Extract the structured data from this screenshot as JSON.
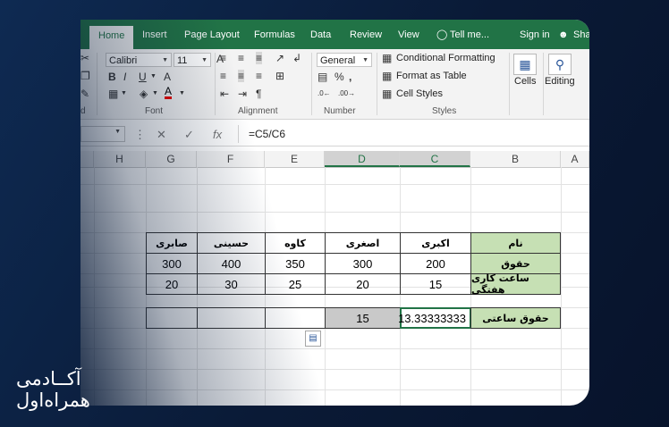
{
  "brand": {
    "line1": "آکــادمی",
    "line2": "همراه‌اول"
  },
  "tabs": {
    "home": "Home",
    "insert": "Insert",
    "page_layout": "Page Layout",
    "formulas": "Formulas",
    "data": "Data",
    "review": "Review",
    "view": "View",
    "tell_me": "Tell me...",
    "signin": "Sign in",
    "share": "Sha"
  },
  "ribbon": {
    "font_name": "Calibri",
    "font_size": "11",
    "number_format": "General",
    "conditional_formatting": "Conditional Formatting",
    "format_as_table": "Format as Table",
    "cell_styles": "Cell Styles",
    "cells": "Cells",
    "editing": "Editing",
    "groups": {
      "clipboard": "d",
      "font": "Font",
      "alignment": "Alignment",
      "number": "Number",
      "styles": "Styles"
    },
    "bold": "B",
    "italic": "I",
    "underline": "U",
    "font_color": "A",
    "percent": "%",
    "comma": ","
  },
  "formula_bar": {
    "formula": "=C5/C6",
    "fx": "fx"
  },
  "columns": [
    "H",
    "G",
    "F",
    "E",
    "D",
    "C",
    "B",
    "A"
  ],
  "table": {
    "header_label": "نام",
    "names": [
      "صابری",
      "حسینی",
      "کاوه",
      "اصغری",
      "اکبری"
    ],
    "row_salary_label": "حقوق",
    "salary": [
      "300",
      "400",
      "350",
      "300",
      "200"
    ],
    "row_hours_label": "ساعت کاری هفتگی",
    "hours": [
      "20",
      "30",
      "25",
      "20",
      "15"
    ],
    "row_hourly_label": "حقوق ساعتی",
    "hourly": [
      "",
      "",
      "",
      "15",
      "13.33333333"
    ]
  },
  "colors": {
    "excel_green": "#217346",
    "label_fill": "#c6e0b4",
    "selected_fill": "#c9c9c9"
  }
}
